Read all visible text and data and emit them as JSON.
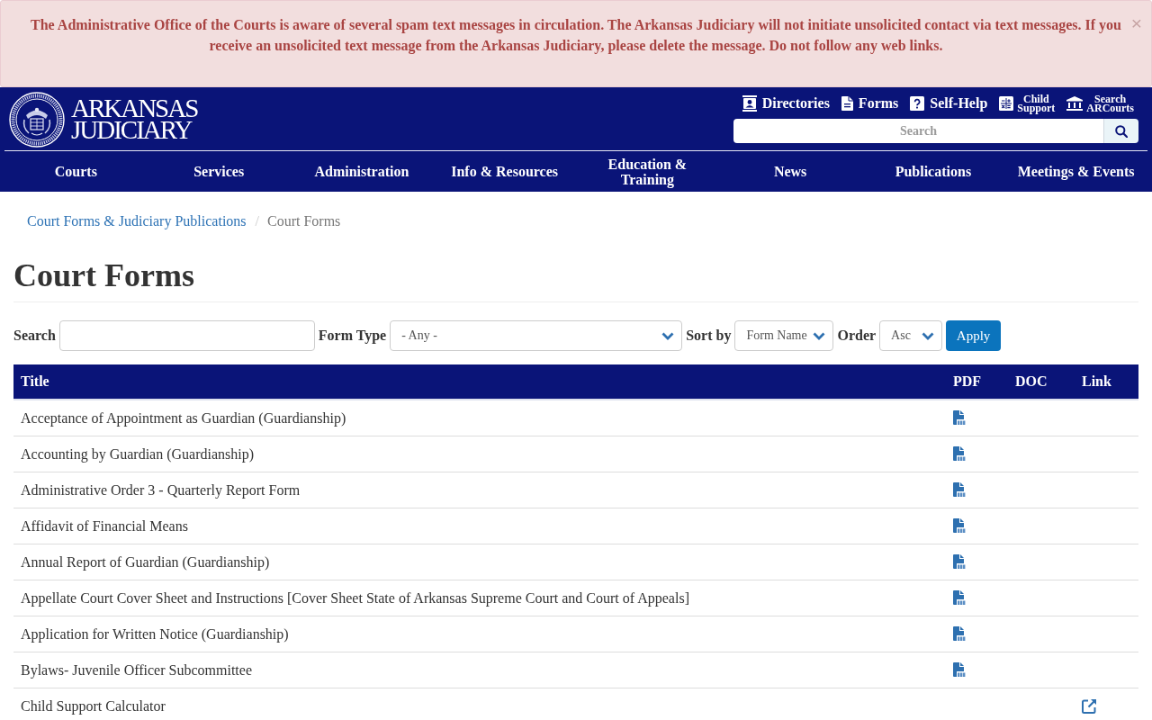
{
  "alert": {
    "message": "The Administrative Office of the Courts is aware of several spam text messages in circulation. The Arkansas Judiciary will not initiate unsolicited contact via text messages. If you receive an unsolicited text message from the Arkansas Judiciary, please delete the message. Do not follow any web links.",
    "close_symbol": "×"
  },
  "header": {
    "logo": {
      "lines": [
        "ARKANSAS",
        "JUDICIARY"
      ]
    },
    "utility_links": [
      {
        "kind": "large",
        "label": "Directories"
      },
      {
        "kind": "large",
        "label": "Forms"
      },
      {
        "kind": "large",
        "label": "Self-Help"
      },
      {
        "kind": "small",
        "lines": [
          "Child",
          "Support"
        ]
      },
      {
        "kind": "small",
        "lines": [
          "Search",
          "ARCourts"
        ]
      }
    ],
    "search": {
      "placeholder": "Search"
    }
  },
  "nav": [
    "Courts",
    "Services",
    "Administration",
    "Info & Resources",
    "Education & Training",
    "News",
    "Publications",
    "Meetings & Events"
  ],
  "breadcrumb": {
    "separator": "/",
    "items": [
      {
        "label": "Court Forms & Judiciary Publications",
        "current": false
      },
      {
        "label": "Court Forms",
        "current": true
      }
    ]
  },
  "page_title": "Court Forms",
  "filters": [
    {
      "kind": "text",
      "label": "Search"
    },
    {
      "kind": "select",
      "label": "Form Type",
      "value": "- Any -"
    },
    {
      "kind": "select",
      "label": "Sort by",
      "value": "Form Name"
    },
    {
      "kind": "select",
      "label": "Order",
      "value": "Asc"
    }
  ],
  "apply_button": "Apply",
  "table": {
    "columns": [
      "Title",
      "PDF",
      "DOC",
      "Link"
    ],
    "rows": [
      {
        "title": "Acceptance of Appointment as Guardian (Guardianship)",
        "pdf": true,
        "doc": false,
        "link": false
      },
      {
        "title": "Accounting by Guardian (Guardianship)",
        "pdf": true,
        "doc": false,
        "link": false
      },
      {
        "title": "Administrative Order 3 - Quarterly Report Form",
        "pdf": true,
        "doc": false,
        "link": false
      },
      {
        "title": "Affidavit of Financial Means",
        "pdf": true,
        "doc": false,
        "link": false
      },
      {
        "title": "Annual Report of Guardian (Guardianship)",
        "pdf": true,
        "doc": false,
        "link": false
      },
      {
        "title": "Appellate Court Cover Sheet and Instructions [Cover Sheet State of Arkansas Supreme Court and Court of Appeals]",
        "pdf": true,
        "doc": false,
        "link": false
      },
      {
        "title": "Application for Written Notice (Guardianship)",
        "pdf": true,
        "doc": false,
        "link": false
      },
      {
        "title": "Bylaws- Juvenile Officer Subcommittee",
        "pdf": true,
        "doc": false,
        "link": false
      },
      {
        "title": "Child Support Calculator",
        "pdf": false,
        "doc": false,
        "link": true
      }
    ]
  }
}
